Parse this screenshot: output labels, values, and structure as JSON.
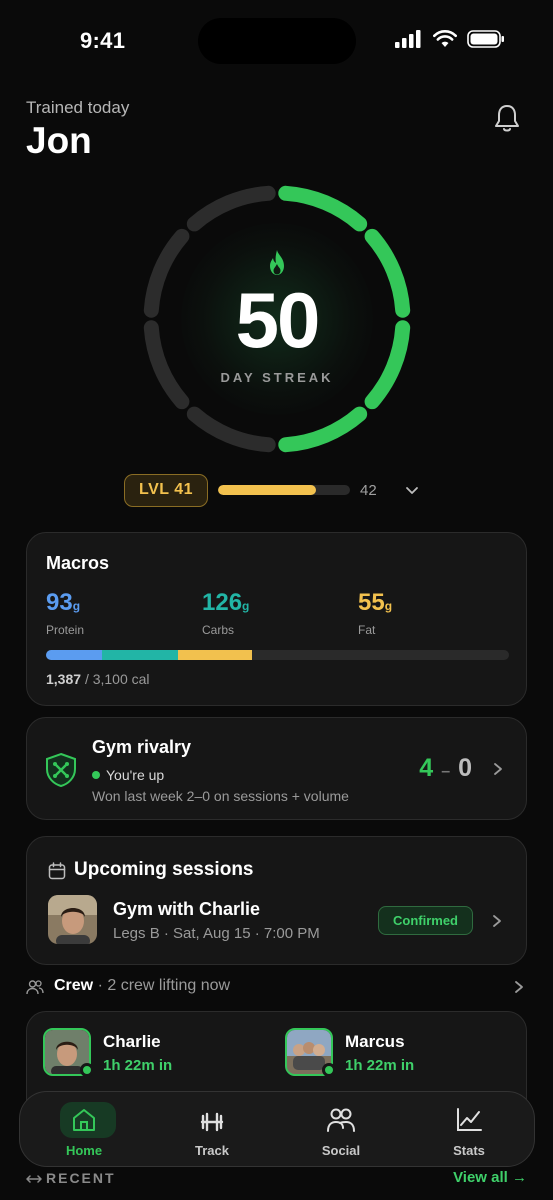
{
  "status_bar": {
    "time": "9:41"
  },
  "header": {
    "greeting": "Trained today",
    "name": "Jon"
  },
  "streak": {
    "value": "50",
    "label": "DAY STREAK",
    "ring_segments_filled": 4,
    "ring_segments_total": 8
  },
  "level": {
    "badge": "LVL 41",
    "next_level": "42",
    "progress": 0.74
  },
  "macros": {
    "title": "Macros",
    "items": [
      {
        "value": "93",
        "unit": "g",
        "name": "Protein",
        "color": "#5b9cf0"
      },
      {
        "value": "126",
        "unit": "g",
        "name": "Carbs",
        "color": "#22b5a6"
      },
      {
        "value": "55",
        "unit": "g",
        "name": "Fat",
        "color": "#f2c14e"
      }
    ],
    "bar_fractions": [
      0.12,
      0.165,
      0.16
    ],
    "calories_current": "1,387",
    "calories_goal": "/ 3,100 cal"
  },
  "rivalry": {
    "title": "Gym rivalry",
    "status": "You're up",
    "subtitle": "Won last week 2–0 on sessions + volume",
    "score_mine": "4",
    "score_sep": "–",
    "score_theirs": "0"
  },
  "sessions": {
    "title": "Upcoming sessions",
    "item": {
      "name": "Gym with Charlie",
      "detail": "Legs B · Sat, Aug 15 · 7:00 PM",
      "badge": "Confirmed"
    }
  },
  "crew": {
    "label": "Crew",
    "summary": "· 2 crew lifting now",
    "members": [
      {
        "name": "Charlie",
        "time": "1h 22m in"
      },
      {
        "name": "Marcus",
        "time": "1h 22m in"
      }
    ]
  },
  "tabs": [
    {
      "label": "Home",
      "icon": "home-icon",
      "active": true
    },
    {
      "label": "Track",
      "icon": "dumbbell-icon",
      "active": false
    },
    {
      "label": "Social",
      "icon": "people-icon",
      "active": false
    },
    {
      "label": "Stats",
      "icon": "chart-icon",
      "active": false
    }
  ],
  "recent": {
    "label": "RECENT",
    "view_all": "View all →"
  },
  "colors": {
    "accent": "#34c759",
    "gold": "#f2c14e",
    "background": "#0a0a0a",
    "card": "#161616"
  }
}
